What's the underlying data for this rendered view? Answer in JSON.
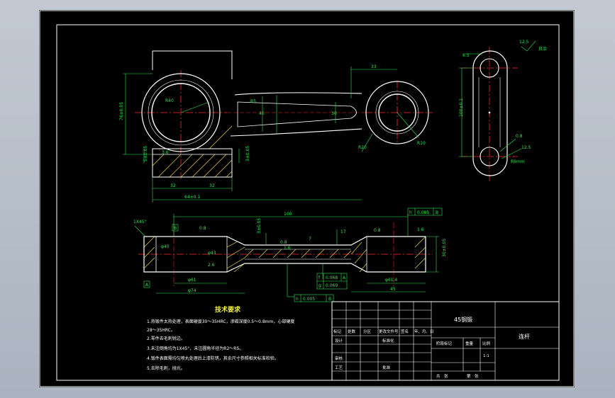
{
  "colors": {
    "background": "#000000",
    "outer_frame": "#ffffff",
    "part_outline": "#ffffff",
    "dimension": "#2ee64a",
    "centerline": "#ff2a2a",
    "section_hatch": "#ffe24a",
    "heading": "#f4f04a"
  },
  "front_view": {
    "dims": {
      "radius_big": "R40",
      "radius_arm": "R5",
      "top_width": "33",
      "center_dist": "100±0.1",
      "thickness_30": "30",
      "rib_40": "40",
      "small_r1": "R20",
      "small_r2": "R10",
      "left_height": "76±0.05",
      "left_low": "5±0.05",
      "gap_3": "3.6",
      "right_low": "3±0.05",
      "bottom_32a": "32",
      "bottom_32b": "32",
      "overall": "64±0.1"
    }
  },
  "side_view": {
    "dims": {
      "roughness_top": "12.5",
      "roughness_label": "其余",
      "edge_small": "6.5",
      "length": "100±0.1",
      "surf_note_1": "0.8",
      "surf_note_2": "12.5",
      "hole_r": "R6mm"
    }
  },
  "section_view": {
    "dims": {
      "chamfer": "1X45°",
      "datum_b": "B",
      "rough_1": "0.8",
      "length_top": "100",
      "right_vert": "3±0.05",
      "dim_7": "7",
      "dim_17": "17",
      "rough_2": "0.8",
      "rough_3": "0.8",
      "flat_h": "h",
      "flat_val": "0.085",
      "flat_b": "B",
      "rough_4": "1.6",
      "right_h": "30±0.05",
      "left_dia": "φ40",
      "left_d2": "φ43",
      "left_2": "2.6",
      "bottom_phi": "φ61",
      "bottom_total": "φ74",
      "datum_a": "A",
      "mid_1": "1.6",
      "tol_f": "f",
      "tol_f_val": "0.068",
      "tol_f_d": "A",
      "tol_g": "g",
      "tol_g_val": "0.069",
      "tol_h": "h",
      "tol_h_val": "0.005",
      "tol_h_d": "B",
      "right_d": "φ61.4",
      "right_45": "45"
    }
  },
  "tech": {
    "title": "技术要求",
    "lines": [
      "1.热锻件太热处理，表面硬度30～35HRC，渗碳深度0.5～0.8mm，心部硬度",
      "  28～35HRC。",
      "2.零件去毛刺锐边。",
      "3.未注倒角均为1X45°，未注圆角半径为R2～R5。",
      "4.锻件表面需均匀喷丸处理后上漆防锈，其余尺寸参照相关标准检验。",
      "5.去除毛刺，抛光。"
    ]
  },
  "title_block": {
    "material": "45钢锻",
    "part_name": "连杆",
    "row_headers": [
      "标记",
      "处数",
      "分区",
      "更改文件号",
      "签名",
      "年、月、日"
    ],
    "design": "设计",
    "standard": "标准化",
    "stage": "阶段标记",
    "weight": "重量",
    "scale_h": "比例",
    "scale": "1:1",
    "check": "审核",
    "process": "工艺",
    "approve": "批准",
    "sheet_total": "共　张",
    "sheet_no": "第　张"
  }
}
